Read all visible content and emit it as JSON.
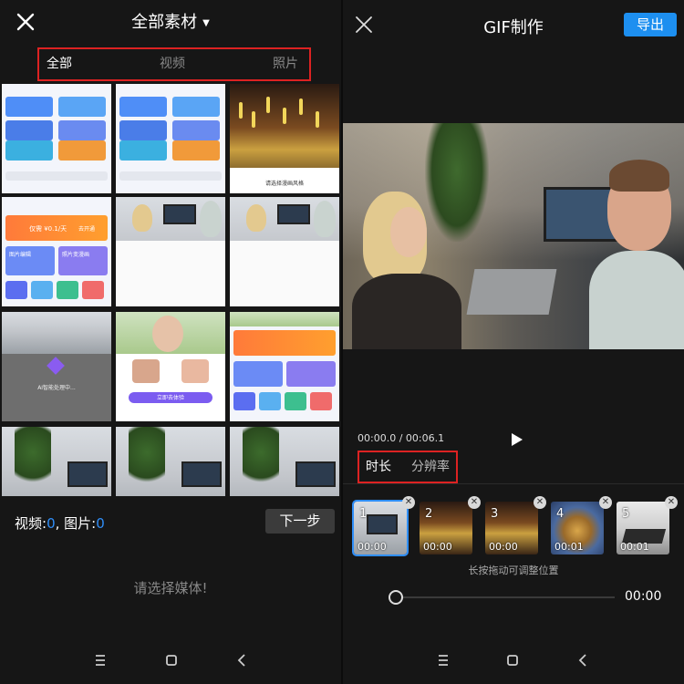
{
  "left": {
    "title": "全部素材",
    "tabs": [
      "全部",
      "视频",
      "照片"
    ],
    "thumb_texts": {
      "style_hint": "请选择漫画风格",
      "processing": "AI智能处理中...",
      "promo": "仅需 ¥0.1/天",
      "vip_btn": "去开通",
      "edit_image": "图片编辑",
      "comic": "照片变漫画",
      "face_btn": "立即去体验"
    },
    "selection": {
      "video_label": "视频:",
      "video_count": "0",
      "sep": ", 图片:",
      "image_count": "0"
    },
    "next_label": "下一步",
    "hint": "请选择媒体!"
  },
  "right": {
    "title": "GIF制作",
    "export_label": "导出",
    "time_current": "00:00.0",
    "time_sep": " / ",
    "time_total": "00:06.1",
    "tabs": [
      "时长",
      "分辨率"
    ],
    "frames": [
      {
        "num": "1",
        "dur": "00:00"
      },
      {
        "num": "2",
        "dur": "00:00"
      },
      {
        "num": "3",
        "dur": "00:00"
      },
      {
        "num": "4",
        "dur": "00:01"
      },
      {
        "num": "5",
        "dur": "00:01"
      }
    ],
    "drag_hint": "长按拖动可调整位置",
    "slider_time": "00:00"
  },
  "icons": {
    "close": "close-icon",
    "caret": "caret-down-icon",
    "play": "play-icon",
    "remove": "remove-x-icon",
    "nav_menu": "menu-icon",
    "nav_home": "home-icon",
    "nav_back": "back-icon"
  },
  "colors": {
    "accent_blue": "#2f8ef9",
    "export_blue": "#1d8ff0",
    "highlight_red": "#dd2222",
    "background": "#161616"
  }
}
